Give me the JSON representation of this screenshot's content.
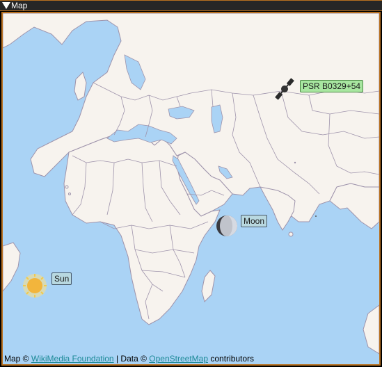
{
  "panel": {
    "title": "Map"
  },
  "markers": {
    "psr": {
      "label": "PSR B0329+54"
    },
    "moon": {
      "label": "Moon"
    },
    "sun": {
      "label": "Sun"
    }
  },
  "attribution": {
    "prefix": "Map ©",
    "map_link": "WikiMedia Foundation",
    "mid": "| Data ©",
    "data_link": "OpenStreetMap",
    "suffix": "contributors"
  },
  "colors": {
    "accent_border": "#b8701f",
    "ocean": "#aad3f5",
    "land": "#f7f3ee",
    "border_lines": "#9e93ab",
    "psr_label_bg": "#a8e6a0",
    "body_label_bg": "#b8d8e0"
  },
  "icons": {
    "collapse": "triangle-down-icon",
    "satellite": "satellite-icon",
    "moon": "moon-icon",
    "sun": "sun-icon"
  }
}
